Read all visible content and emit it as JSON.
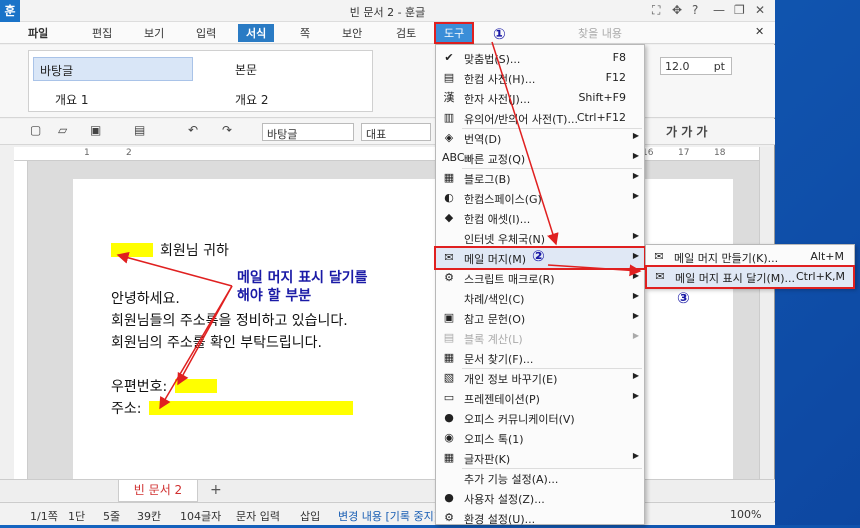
{
  "window": {
    "title": "빈 문서 2 - 훈글",
    "app_icon": "훈",
    "controls": [
      "⛶",
      "✥",
      "?",
      "—",
      "❐",
      "✕"
    ]
  },
  "menubar": {
    "file": "파일",
    "items": [
      "편집",
      "보기",
      "입력",
      "서식",
      "쪽",
      "보안",
      "검토",
      "도구"
    ],
    "search_placeholder": "찾을 내용",
    "close": "✕"
  },
  "ribbon": {
    "styles": [
      [
        "바탕글",
        "본문"
      ],
      [
        "개요 1",
        "개요 2"
      ]
    ],
    "font_size": "12.0",
    "font_unit": "pt",
    "zoom_label": "100%"
  },
  "toolbar": {
    "style_combo": "바탕글",
    "font_combo": "대표",
    "bold_italic": "가 가 가"
  },
  "ruler": {
    "labels": [
      "1",
      "2",
      "16",
      "17",
      "18"
    ]
  },
  "document": {
    "lines": [
      "회원님 귀하",
      "안녕하세요.",
      "회원님들의 주소록을 정비하고 있습니다.",
      "회원님의 주소를 확인 부탁드립니다.",
      "우편번호:",
      "주소:"
    ],
    "annotation": [
      "메일 머지 표시 달기를",
      "해야 할 부분"
    ]
  },
  "tabs": {
    "doc_tab": "빈 문서 2",
    "add": "+"
  },
  "status": {
    "page": "1/1쪽",
    "section": "1단",
    "line": "5줄",
    "col": "39칸",
    "chars": "104글자",
    "mode": "문자 입력",
    "insert": "삽입",
    "track": "변경 내용 [기록 중지]",
    "zoom": "100%"
  },
  "menu": {
    "items": [
      {
        "label": "맞춤법(S)...",
        "shortcut": "F8",
        "icon": "✔",
        "arrow": false
      },
      {
        "label": "한컴 사전(H)...",
        "shortcut": "F12",
        "icon": "▤",
        "arrow": false
      },
      {
        "label": "한자 사전(J)...",
        "shortcut": "Shift+F9",
        "icon": "漢",
        "arrow": false
      },
      {
        "label": "유의어/반의어 사전(T)...",
        "shortcut": "Ctrl+F12",
        "icon": "▥",
        "arrow": false
      },
      {
        "label": "번역(D)",
        "shortcut": "",
        "icon": "◈",
        "arrow": true
      },
      {
        "label": "빠른 교정(Q)",
        "shortcut": "",
        "icon": "ABC",
        "arrow": true
      },
      {
        "label": "블로그(B)",
        "shortcut": "",
        "icon": "▦",
        "arrow": true
      },
      {
        "label": "한컴스페이스(G)",
        "shortcut": "",
        "icon": "◐",
        "arrow": true
      },
      {
        "label": "한컴 애셋(I)...",
        "shortcut": "",
        "icon": "◆",
        "arrow": false
      },
      {
        "label": "인터넷 우체국(N)",
        "shortcut": "",
        "icon": "",
        "arrow": true
      },
      {
        "label": "메일 머지(M)",
        "shortcut": "",
        "icon": "✉",
        "arrow": true
      },
      {
        "label": "스크립트 매크로(R)",
        "shortcut": "",
        "icon": "⚙",
        "arrow": true
      },
      {
        "label": "차례/색인(C)",
        "shortcut": "",
        "icon": "",
        "arrow": true
      },
      {
        "label": "참고 문헌(O)",
        "shortcut": "",
        "icon": "▣",
        "arrow": true
      },
      {
        "label": "블록 계산(L)",
        "shortcut": "",
        "icon": "▤",
        "arrow": true
      },
      {
        "label": "문서 찾기(F)...",
        "shortcut": "",
        "icon": "▦",
        "arrow": false
      },
      {
        "label": "개인 정보 바꾸기(E)",
        "shortcut": "",
        "icon": "▧",
        "arrow": true
      },
      {
        "label": "프레젠테이션(P)",
        "shortcut": "",
        "icon": "▭",
        "arrow": true
      },
      {
        "label": "오피스 커뮤니케이터(V)",
        "shortcut": "",
        "icon": "●",
        "arrow": false
      },
      {
        "label": "오피스 톡(1)",
        "shortcut": "",
        "icon": "◉",
        "arrow": false
      },
      {
        "label": "글자판(K)",
        "shortcut": "",
        "icon": "▦",
        "arrow": true
      },
      {
        "label": "추가 기능 설정(A)...",
        "shortcut": "",
        "icon": "",
        "arrow": false
      },
      {
        "label": "사용자 설정(Z)...",
        "shortcut": "",
        "icon": "●",
        "arrow": false
      },
      {
        "label": "환경 설정(U)...",
        "shortcut": "",
        "icon": "⚙",
        "arrow": false
      }
    ]
  },
  "submenu": {
    "items": [
      {
        "label": "메일 머지 만들기(K)...",
        "shortcut": "Alt+M"
      },
      {
        "label": "메일 머지 표시 달기(M)...",
        "shortcut": "Ctrl+K,M"
      }
    ]
  },
  "callouts": [
    "①",
    "②",
    "③"
  ],
  "colors": {
    "highlight": "#ffff00",
    "annotation": "#1a1aa6",
    "arrow": "#e02020",
    "accent": "#2a7bc4"
  }
}
